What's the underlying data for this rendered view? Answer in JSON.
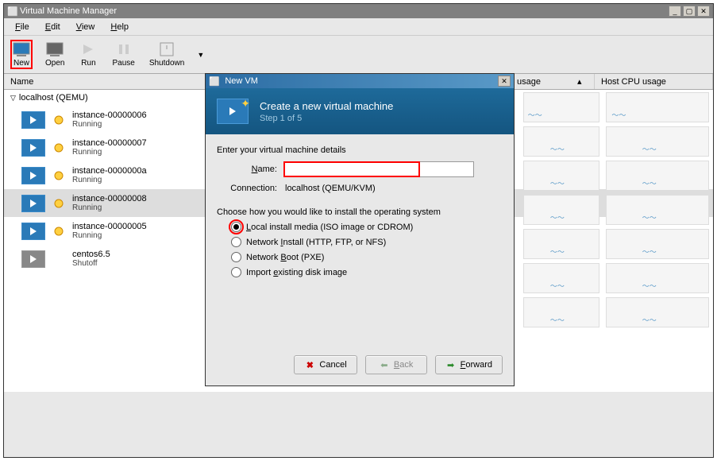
{
  "main": {
    "title": "Virtual Machine Manager",
    "menubar": [
      "File",
      "Edit",
      "View",
      "Help"
    ],
    "toolbar": {
      "new": "New",
      "open": "Open",
      "run": "Run",
      "pause": "Pause",
      "shutdown": "Shutdown"
    },
    "columns": {
      "name": "Name",
      "usage": "usage",
      "host": "Host CPU usage"
    },
    "group": "localhost (QEMU)",
    "vms": [
      {
        "name": "instance-00000006",
        "state": "Running",
        "running": true
      },
      {
        "name": "instance-00000007",
        "state": "Running",
        "running": true
      },
      {
        "name": "instance-0000000a",
        "state": "Running",
        "running": true
      },
      {
        "name": "instance-00000008",
        "state": "Running",
        "running": true,
        "selected": true
      },
      {
        "name": "instance-00000005",
        "state": "Running",
        "running": true
      },
      {
        "name": "centos6.5",
        "state": "Shutoff",
        "running": false
      }
    ]
  },
  "dialog": {
    "title": "New VM",
    "header_title": "Create a new virtual machine",
    "header_step": "Step 1 of 5",
    "intro": "Enter your virtual machine details",
    "name_label": "Name:",
    "name_value": "",
    "conn_label": "Connection:",
    "conn_value": "localhost (QEMU/KVM)",
    "choose_label": "Choose how you would like to install the operating system",
    "options": [
      {
        "label": "Local install media (ISO image or CDROM)",
        "accel": "L",
        "checked": true
      },
      {
        "label": "Network Install (HTTP, FTP, or NFS)",
        "accel": "I",
        "checked": false
      },
      {
        "label": "Network Boot (PXE)",
        "accel": "B",
        "checked": false
      },
      {
        "label": "Import existing disk image",
        "accel": "e",
        "checked": false
      }
    ],
    "buttons": {
      "cancel": "Cancel",
      "back": "Back",
      "forward": "Forward"
    }
  }
}
